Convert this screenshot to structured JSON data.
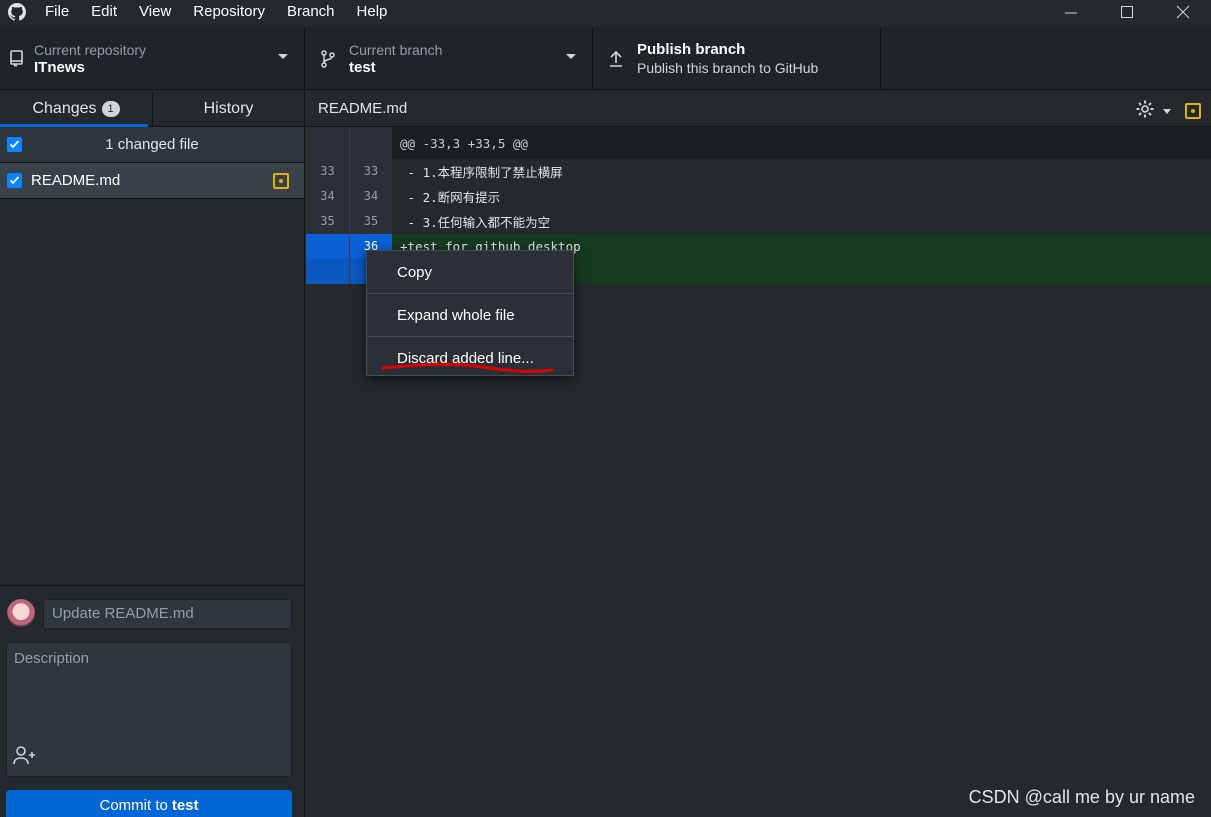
{
  "menu": {
    "items": [
      "File",
      "Edit",
      "View",
      "Repository",
      "Branch",
      "Help"
    ]
  },
  "toolbar": {
    "repo_sub": "Current repository",
    "repo_name": "ITnews",
    "branch_sub": "Current branch",
    "branch_name": "test",
    "publish_title": "Publish branch",
    "publish_sub": "Publish this branch to GitHub"
  },
  "sidebar": {
    "tab_changes": "Changes",
    "tab_changes_count": "1",
    "tab_history": "History",
    "changed_header": "1 changed file",
    "files": [
      {
        "name": "README.md"
      }
    ],
    "summary_placeholder": "Update README.md",
    "description_placeholder": "Description",
    "commit_label": "Commit to",
    "commit_branch": "test"
  },
  "diff": {
    "filename": "README.md",
    "hunk": "@@ -33,3 +33,5 @@",
    "lines": [
      {
        "old": "33",
        "new": "33",
        "text": " - 1.本程序限制了禁止横屏"
      },
      {
        "old": "34",
        "new": "34",
        "text": " - 2.断网有提示"
      },
      {
        "old": "35",
        "new": "35",
        "text": " - 3.任何输入都不能为空"
      },
      {
        "old": "",
        "new": "36",
        "text": "+test for github desktop"
      },
      {
        "old": "",
        "new": "",
        "text": ""
      }
    ]
  },
  "context_menu": {
    "copy": "Copy",
    "expand": "Expand whole file",
    "discard": "Discard added line..."
  },
  "watermark": "CSDN @call me by ur name",
  "colors": {
    "accent": "#0366d6",
    "added_bg": "#153a1f",
    "modified": "#e0b400",
    "annotation": "#e00000"
  }
}
